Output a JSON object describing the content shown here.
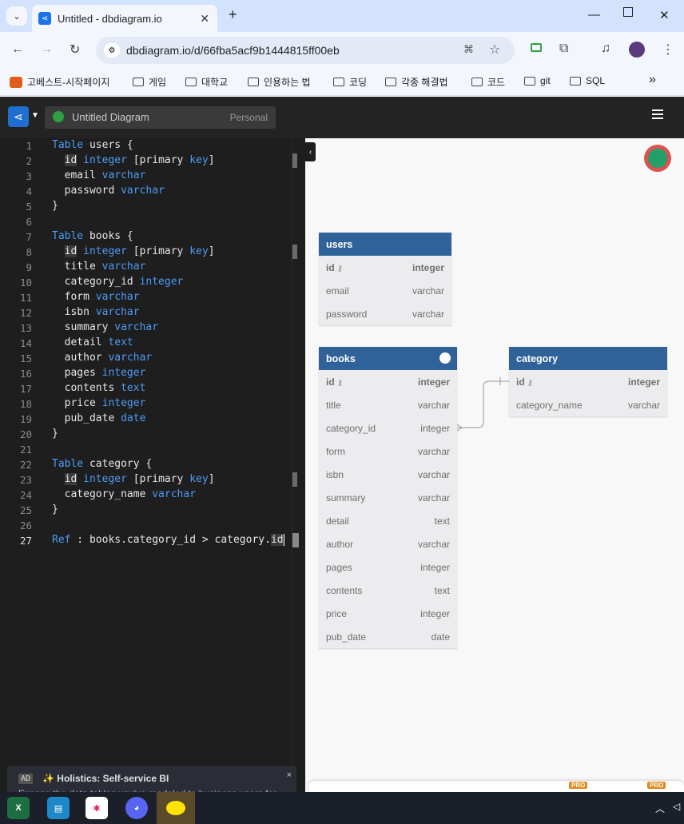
{
  "browser": {
    "tab_title": "Untitled - dbdiagram.io",
    "url": "dbdiagram.io/d/66fba5acf9b1444815ff00eb",
    "bookmarks": [
      "고베스트-시작페이지",
      "게임",
      "대학교",
      "인용하는 법",
      "코딩",
      "각종 해결법",
      "코드",
      "git",
      "SQL"
    ],
    "more_bookmarks": "»"
  },
  "app": {
    "diagram_name": "Untitled Diagram",
    "workspace": "Personal"
  },
  "editor": {
    "lines": [
      {
        "n": "1",
        "t": ""
      },
      {
        "n": "2",
        "t": ""
      },
      {
        "n": "3",
        "t": ""
      },
      {
        "n": "4",
        "t": ""
      },
      {
        "n": "5",
        "t": ""
      },
      {
        "n": "6",
        "t": ""
      },
      {
        "n": "7",
        "t": ""
      },
      {
        "n": "8",
        "t": ""
      },
      {
        "n": "9",
        "t": ""
      },
      {
        "n": "10",
        "t": ""
      },
      {
        "n": "11",
        "t": ""
      },
      {
        "n": "12",
        "t": ""
      },
      {
        "n": "13",
        "t": ""
      },
      {
        "n": "14",
        "t": ""
      },
      {
        "n": "15",
        "t": ""
      },
      {
        "n": "16",
        "t": ""
      },
      {
        "n": "17",
        "t": ""
      },
      {
        "n": "18",
        "t": ""
      },
      {
        "n": "19",
        "t": ""
      },
      {
        "n": "20",
        "t": ""
      },
      {
        "n": "21",
        "t": ""
      },
      {
        "n": "22",
        "t": ""
      },
      {
        "n": "23",
        "t": ""
      },
      {
        "n": "24",
        "t": ""
      },
      {
        "n": "25",
        "t": ""
      },
      {
        "n": "26",
        "t": ""
      },
      {
        "n": "27",
        "t": ""
      }
    ],
    "tokens": {
      "table": "Table",
      "users": "users {",
      "id": "id",
      "integer": "integer",
      "pk_open": "[primary",
      "key": "key",
      "pk_close": "]",
      "email": "email",
      "varchar": "varchar",
      "password": "password",
      "close_brace": "}",
      "books": "books {",
      "title": "title",
      "category_id": "category_id",
      "form": "form",
      "isbn": "isbn",
      "summary": "summary",
      "detail": "detail",
      "text": "text",
      "author": "author",
      "pages": "pages",
      "contents": "contents",
      "price": "price",
      "pub_date": "pub_date",
      "date": "date",
      "category": "category {",
      "category_name": "category_name",
      "ref": "Ref",
      "ref_rest": " : books.category_id > category.",
      "ref_id": "id"
    }
  },
  "ad": {
    "badge": "AD",
    "title": "✨ Holistics: Self-service BI",
    "subtitle": "Expose the data tables you've modeled to business users for",
    "close": "×"
  },
  "diagram": {
    "tables": [
      {
        "name": "users",
        "columns": [
          {
            "name": "id",
            "type": "integer",
            "pk": true
          },
          {
            "name": "email",
            "type": "varchar"
          },
          {
            "name": "password",
            "type": "varchar"
          }
        ]
      },
      {
        "name": "books",
        "columns": [
          {
            "name": "id",
            "type": "integer",
            "pk": true
          },
          {
            "name": "title",
            "type": "varchar"
          },
          {
            "name": "category_id",
            "type": "integer"
          },
          {
            "name": "form",
            "type": "varchar"
          },
          {
            "name": "isbn",
            "type": "varchar"
          },
          {
            "name": "summary",
            "type": "varchar"
          },
          {
            "name": "detail",
            "type": "text"
          },
          {
            "name": "author",
            "type": "varchar"
          },
          {
            "name": "pages",
            "type": "integer"
          },
          {
            "name": "contents",
            "type": "text"
          },
          {
            "name": "price",
            "type": "integer"
          },
          {
            "name": "pub_date",
            "type": "date"
          }
        ]
      },
      {
        "name": "category",
        "columns": [
          {
            "name": "id",
            "type": "integer",
            "pk": true
          },
          {
            "name": "category_name",
            "type": "varchar"
          }
        ]
      }
    ],
    "pro_badge": "PRO"
  },
  "colors": {
    "table_header": "#2f6299",
    "keyword": "#4d9cf5",
    "editor_bg": "#1e1e1e"
  }
}
